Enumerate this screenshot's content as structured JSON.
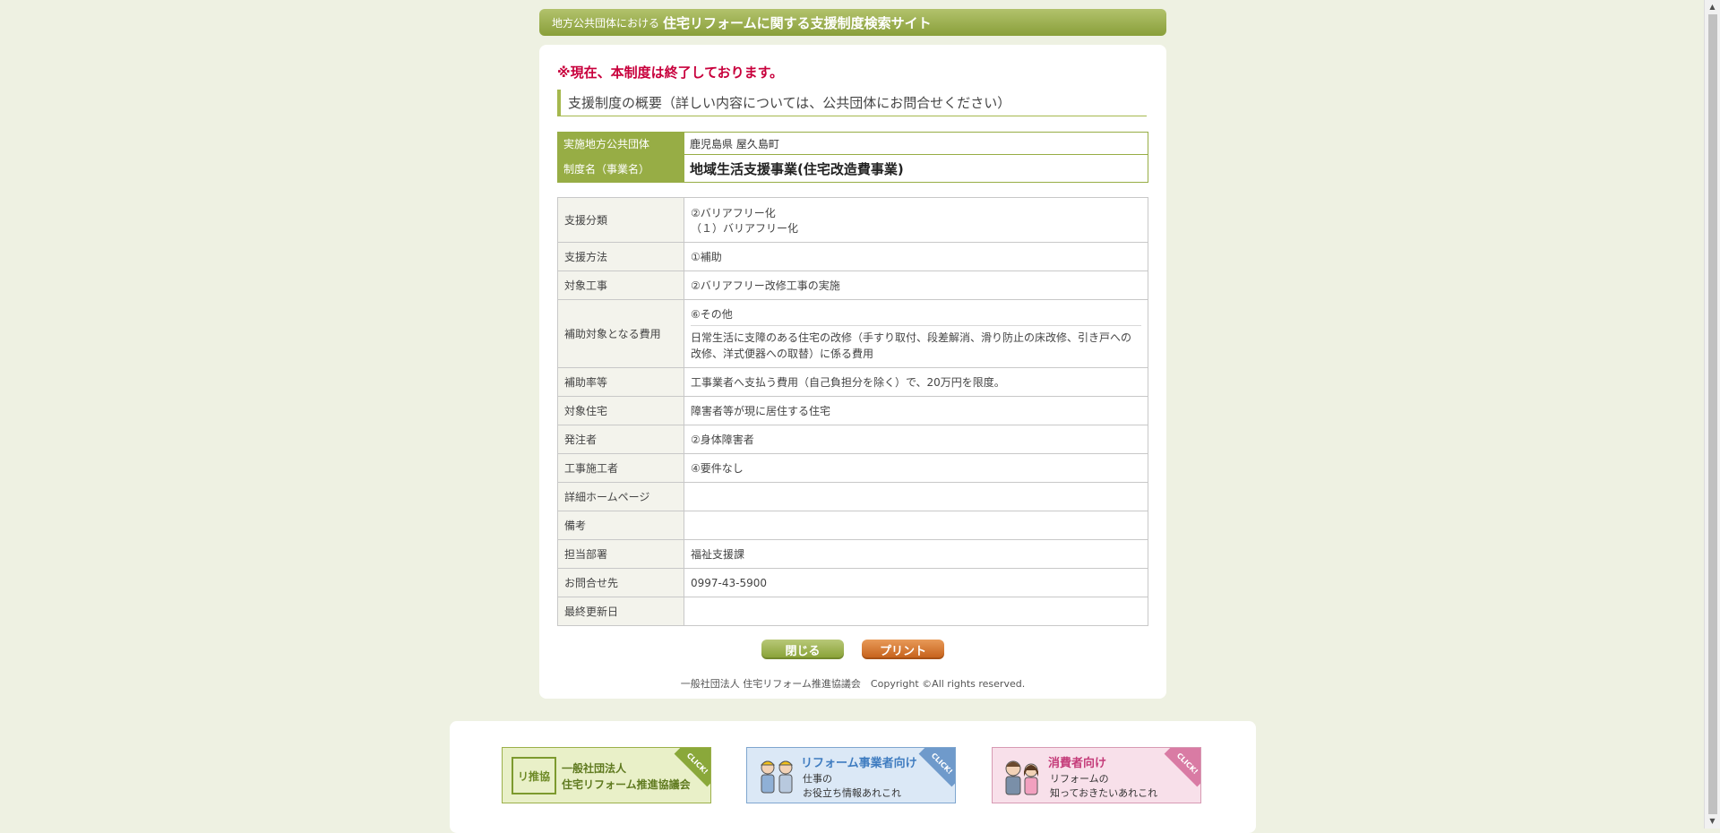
{
  "header": {
    "subtitle": "地方公共団体における",
    "title": "住宅リフォームに関する支援制度検索サイト"
  },
  "notice": "※現在、本制度は終了しております。",
  "section_title": "支援制度の概要（詳しい内容については、公共団体にお問合せください）",
  "summary": {
    "municipality_label": "実施地方公共団体",
    "municipality_value": "鹿児島県 屋久島町",
    "program_label": "制度名（事業名）",
    "program_value": "地域生活支援事業(住宅改造費事業)"
  },
  "details": [
    {
      "label": "支援分類",
      "lines": [
        "②バリアフリー化",
        "（１）バリアフリー化"
      ]
    },
    {
      "label": "支援方法",
      "lines": [
        "①補助"
      ]
    },
    {
      "label": "対象工事",
      "lines": [
        "②バリアフリー改修工事の実施"
      ]
    },
    {
      "label": "補助対象となる費用",
      "lines": [
        "⑥その他"
      ],
      "note": "日常生活に支障のある住宅の改修（手すり取付、段差解消、滑り防止の床改修、引き戸への改修、洋式便器への取替）に係る費用"
    },
    {
      "label": "補助率等",
      "lines": [
        "工事業者へ支払う費用（自己負担分を除く）で、20万円を限度。"
      ]
    },
    {
      "label": "対象住宅",
      "lines": [
        "障害者等が現に居住する住宅"
      ]
    },
    {
      "label": "発注者",
      "lines": [
        "②身体障害者"
      ]
    },
    {
      "label": "工事施工者",
      "lines": [
        "④要件なし"
      ]
    },
    {
      "label": "詳細ホームページ",
      "lines": [
        ""
      ]
    },
    {
      "label": "備考",
      "lines": [
        ""
      ]
    },
    {
      "label": "担当部署",
      "lines": [
        "福祉支援課"
      ]
    },
    {
      "label": "お問合せ先",
      "lines": [
        "0997-43-5900"
      ]
    },
    {
      "label": "最終更新日",
      "lines": [
        ""
      ]
    }
  ],
  "buttons": {
    "close": "閉じる",
    "print": "プリント"
  },
  "footer": "一般社団法人 住宅リフォーム推進協議会　Copyright ©All rights reserved.",
  "banners": [
    {
      "corner": "CLICK!",
      "logo": "リ推協",
      "line1": "一般社団法人",
      "line2": "住宅リフォーム推進協議会"
    },
    {
      "corner": "CLICK!",
      "line1": "リフォーム事業者向け",
      "line2": "仕事の",
      "line3": "お役立ち情報あれこれ"
    },
    {
      "corner": "CLICK!",
      "line1": "消費者向け",
      "line2": "リフォームの",
      "line3": "知っておきたいあれこれ"
    }
  ]
}
